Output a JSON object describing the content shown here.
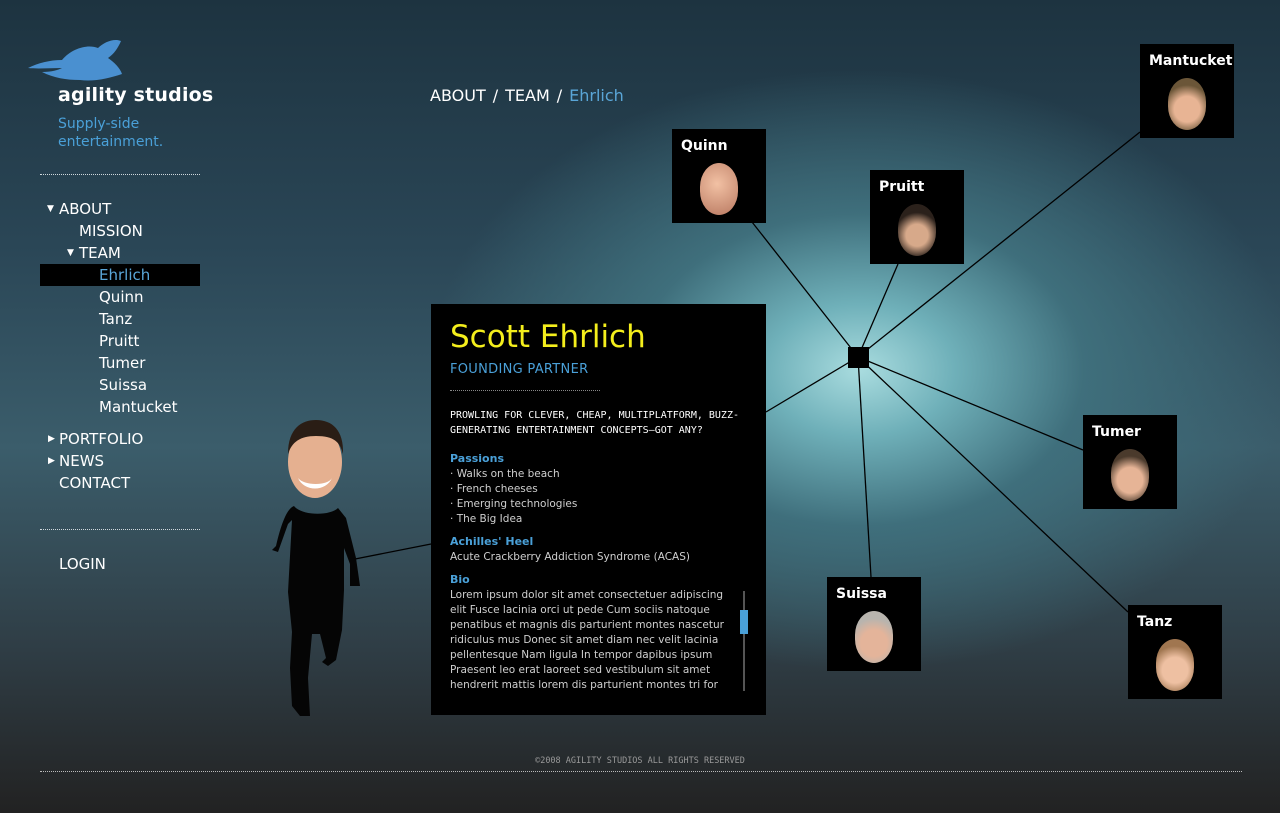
{
  "brand": {
    "name": "agility studios",
    "tagline": "Supply-side entertainment."
  },
  "nav": {
    "items": [
      {
        "label": "ABOUT",
        "arrow": "down"
      },
      {
        "label": "MISSION",
        "arrow": "none"
      },
      {
        "label": "TEAM",
        "arrow": "down"
      },
      {
        "label": "Ehrlich",
        "arrow": "none",
        "active": true
      },
      {
        "label": "Quinn",
        "arrow": "none"
      },
      {
        "label": "Tanz",
        "arrow": "none"
      },
      {
        "label": "Pruitt",
        "arrow": "none"
      },
      {
        "label": "Tumer",
        "arrow": "none"
      },
      {
        "label": "Suissa",
        "arrow": "none"
      },
      {
        "label": "Mantucket",
        "arrow": "none"
      },
      {
        "label": "PORTFOLIO",
        "arrow": "right"
      },
      {
        "label": "NEWS",
        "arrow": "right"
      },
      {
        "label": "CONTACT",
        "arrow": "none"
      }
    ],
    "login": "LOGIN"
  },
  "breadcrumb": {
    "items": [
      "ABOUT",
      "TEAM"
    ],
    "current": "Ehrlich",
    "separator": "/"
  },
  "team_nodes": [
    {
      "name": "Quinn"
    },
    {
      "name": "Pruitt"
    },
    {
      "name": "Mantucket"
    },
    {
      "name": "Tumer"
    },
    {
      "name": "Suissa"
    },
    {
      "name": "Tanz"
    }
  ],
  "profile": {
    "name": "Scott Ehrlich",
    "title": "FOUNDING PARTNER",
    "mission": "PROWLING FOR CLEVER, CHEAP, MULTIPLATFORM, BUZZ-GENERATING ENTERTAINMENT CONCEPTS—GOT ANY?",
    "passions_heading": "Passions",
    "passions": [
      "Walks on the beach",
      "French cheeses",
      "Emerging technologies",
      "The Big Idea"
    ],
    "achilles_heading": "Achilles' Heel",
    "achilles": "Acute Crackberry Addiction Syndrome (ACAS)",
    "bio_heading": "Bio",
    "bio": "Lorem ipsum dolor sit amet consectetuer adipiscing elit Fusce lacinia orci ut pede Cum sociis natoque penatibus et magnis dis parturient montes nascetur ridiculus mus Donec sit amet diam nec velit lacinia pellentesque Nam ligula In tempor dapibus ipsum Praesent leo erat laoreet sed vestibulum sit amet hendrerit mattis lorem dis parturient montes tri for"
  },
  "footer": {
    "copyright": "©2008 AGILITY STUDIOS ALL RIGHTS RESERVED"
  },
  "colors": {
    "accent": "#4aa0d8",
    "name_yellow": "#f4ee1c",
    "panel": "#000000"
  },
  "icons": {
    "logo": "bird-logo-icon",
    "expanded": "triangle-down-icon",
    "collapsed": "triangle-right-icon",
    "hub": "hub-square-icon"
  }
}
